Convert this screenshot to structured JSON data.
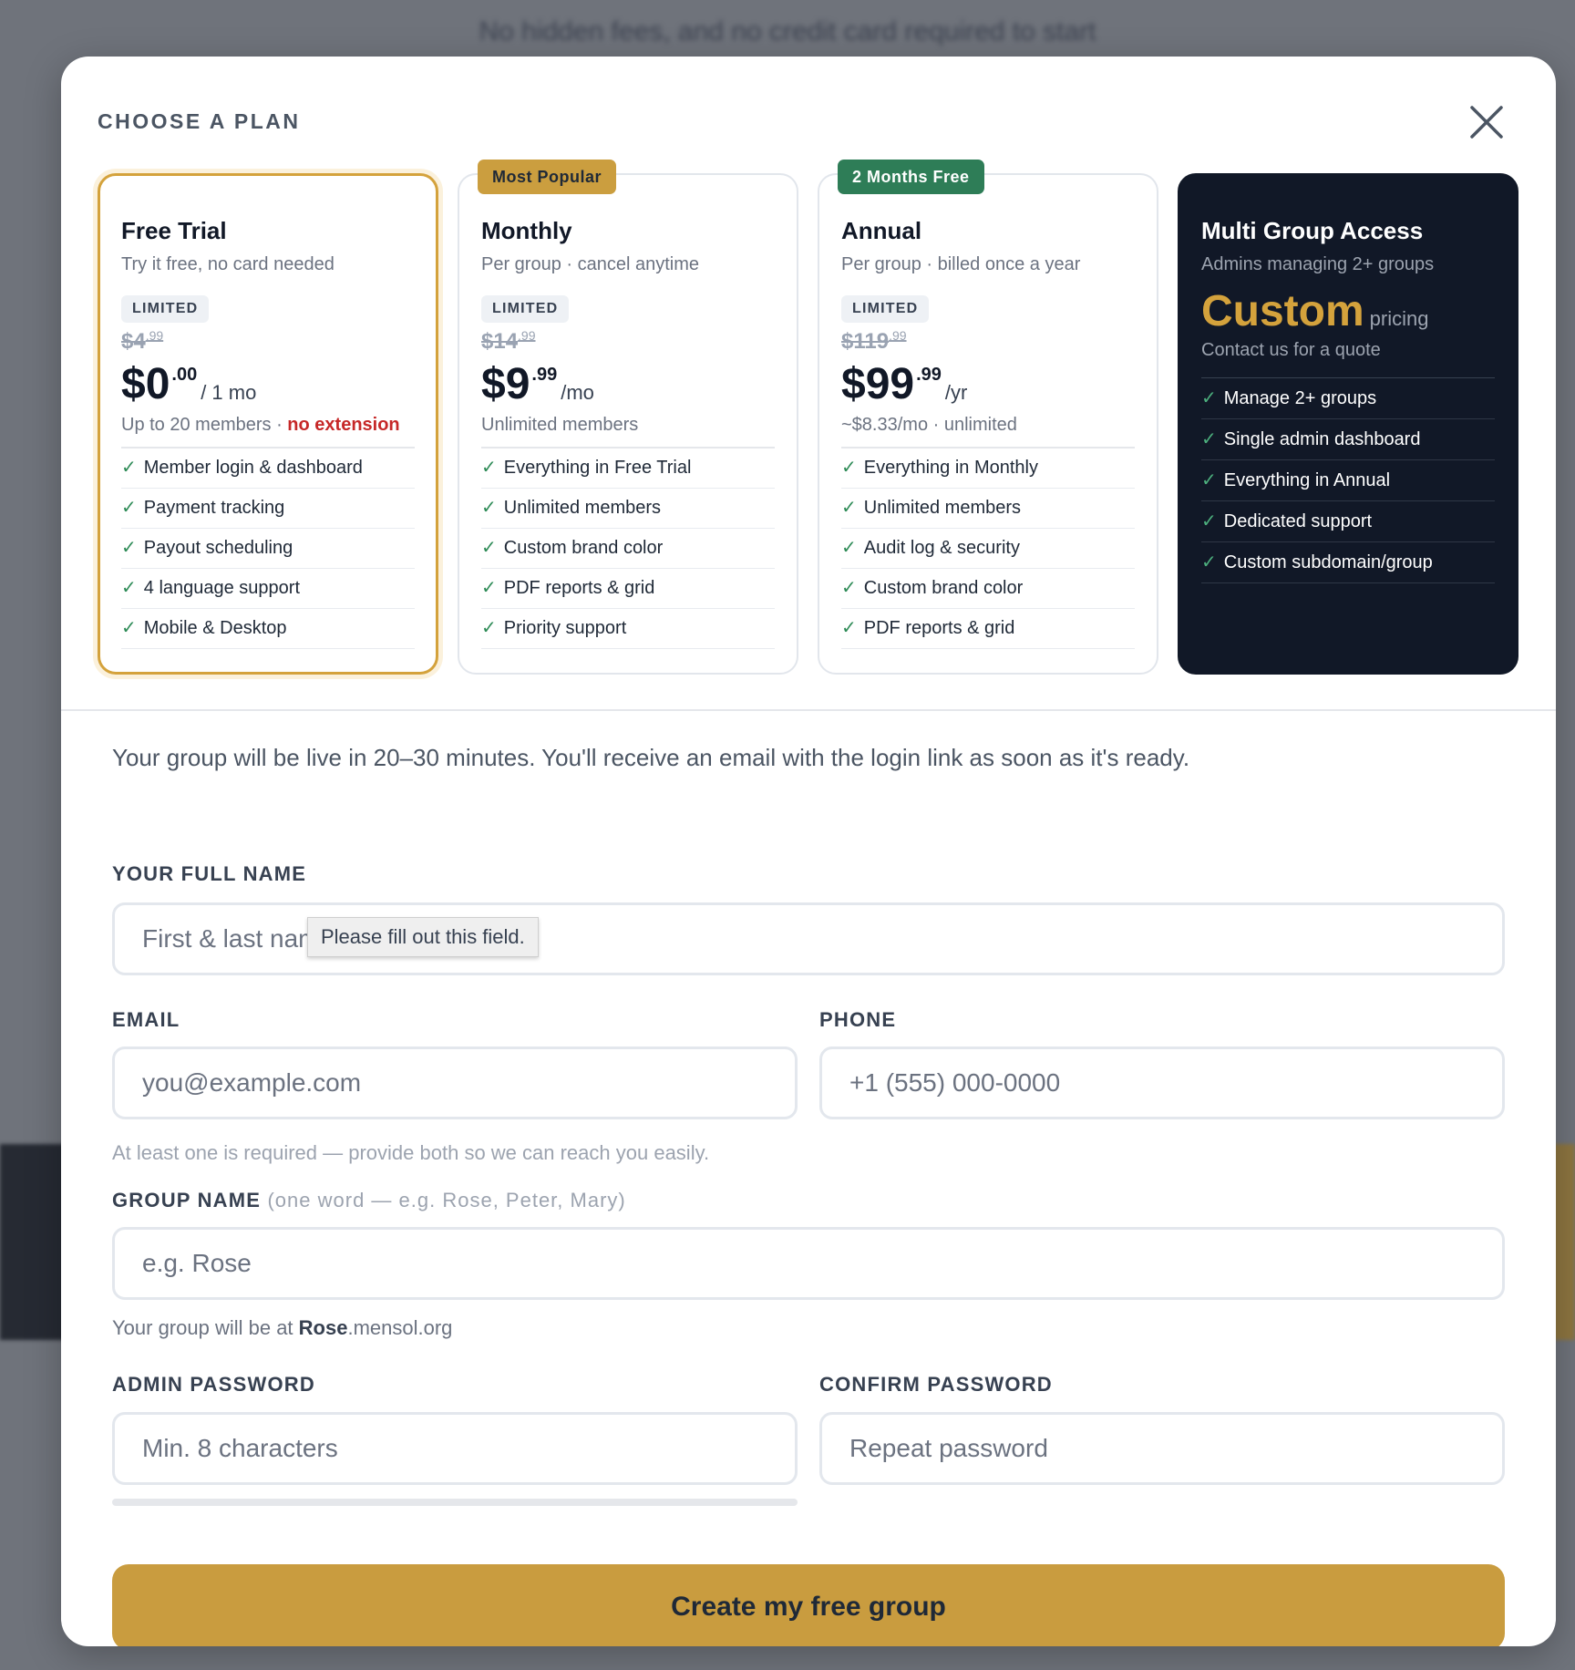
{
  "background": {
    "hint": "No hidden fees, and no credit card required to start"
  },
  "modal": {
    "title": "CHOOSE A PLAN"
  },
  "plans": [
    {
      "name": "Free Trial",
      "subtitle": "Try it free, no card needed",
      "limited": "LIMITED",
      "old_price": "$4",
      "old_cents": ".99",
      "price": "$0",
      "cents": ".00",
      "per": "/ 1 mo",
      "note": "Up to 20 members · ",
      "note_warn": "no extension",
      "selected": true,
      "features": [
        "Member login & dashboard",
        "Payment tracking",
        "Payout scheduling",
        "4 language support",
        "Mobile & Desktop"
      ]
    },
    {
      "name": "Monthly",
      "badge": "Most Popular",
      "subtitle": "Per group · cancel anytime",
      "limited": "LIMITED",
      "old_price": "$14",
      "old_cents": ".99",
      "price": "$9",
      "cents": ".99",
      "per": "/mo",
      "note": "Unlimited members",
      "features": [
        "Everything in Free Trial",
        "Unlimited members",
        "Custom brand color",
        "PDF reports & grid",
        "Priority support"
      ]
    },
    {
      "name": "Annual",
      "badge": "2 Months Free",
      "subtitle": "Per group · billed once a year",
      "limited": "LIMITED",
      "old_price": "$119",
      "old_cents": ".99",
      "price": "$99",
      "cents": ".99",
      "per": "/yr",
      "note": "~$8.33/mo · unlimited",
      "features": [
        "Everything in Monthly",
        "Unlimited members",
        "Audit log & security",
        "Custom brand color",
        "PDF reports & grid"
      ]
    },
    {
      "name": "Multi Group Access",
      "subtitle": "Admins managing 2+ groups",
      "custom": "Custom",
      "custom_suffix": "pricing",
      "contact": "Contact us for a quote",
      "features": [
        "Manage 2+ groups",
        "Single admin dashboard",
        "Everything in Annual",
        "Dedicated support",
        "Custom subdomain/group"
      ]
    }
  ],
  "form": {
    "intro": "Your group will be live in 20–30 minutes. You'll receive an email with the login link as soon as it's ready.",
    "full_name": {
      "label": "YOUR FULL NAME",
      "placeholder": "First & last name"
    },
    "tooltip": "Please fill out this field.",
    "email": {
      "label": "EMAIL",
      "placeholder": "you@example.com"
    },
    "phone": {
      "label": "PHONE",
      "placeholder": "+1 (555) 000-0000"
    },
    "contact_helper": "At least one is required — provide both so we can reach you easily.",
    "group": {
      "label": "GROUP NAME",
      "hint": "(one word — e.g. Rose, Peter, Mary)",
      "placeholder": "e.g. Rose"
    },
    "group_helper_pre": "Your group will be at ",
    "group_helper_name": "Rose",
    "group_helper_domain": ".mensol.org",
    "password": {
      "label": "ADMIN PASSWORD",
      "placeholder": "Min. 8 characters"
    },
    "confirm": {
      "label": "CONFIRM PASSWORD",
      "placeholder": "Repeat password"
    },
    "submit": "Create my free group"
  },
  "icons": {
    "close": "close-icon",
    "check": "check-icon"
  },
  "colors": {
    "accent": "#c99c3f",
    "selected_border": "#d4a23c",
    "badge_green": "#2e7d57",
    "dark_card": "#111827",
    "check": "#2e8b57",
    "warn": "#c62828"
  }
}
